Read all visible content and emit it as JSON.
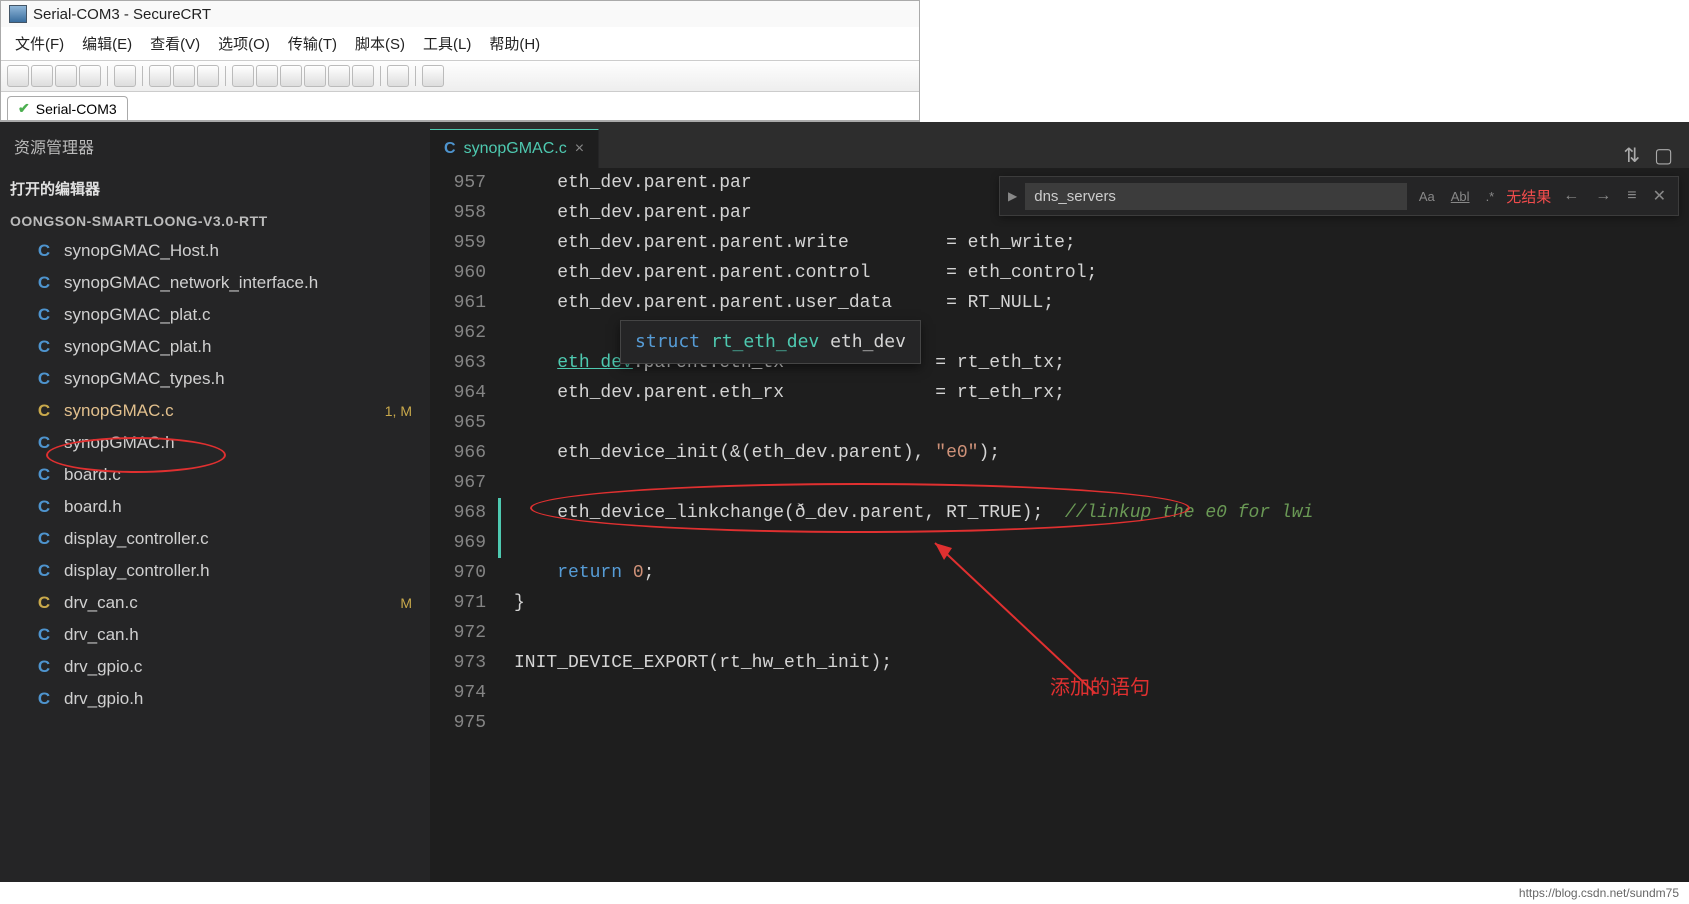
{
  "crt": {
    "title": "Serial-COM3 - SecureCRT",
    "menu": [
      "文件(F)",
      "编辑(E)",
      "查看(V)",
      "选项(O)",
      "传输(T)",
      "脚本(S)",
      "工具(L)",
      "帮助(H)"
    ],
    "tab_label": "Serial-COM3"
  },
  "vscode": {
    "explorer_title": "资源管理器",
    "open_editors_label": "打开的编辑器",
    "project_name": "OONGSON-SMARTLOONG-V3.0-RTT",
    "files": [
      {
        "name": "synopGMAC_Host.h",
        "status": ""
      },
      {
        "name": "synopGMAC_network_interface.h",
        "status": ""
      },
      {
        "name": "synopGMAC_plat.c",
        "status": ""
      },
      {
        "name": "synopGMAC_plat.h",
        "status": ""
      },
      {
        "name": "synopGMAC_types.h",
        "status": ""
      },
      {
        "name": "synopGMAC.c",
        "status": "1, M",
        "active": true,
        "yellow": true
      },
      {
        "name": "synopGMAC.h",
        "status": ""
      },
      {
        "name": "board.c",
        "status": ""
      },
      {
        "name": "board.h",
        "status": ""
      },
      {
        "name": "display_controller.c",
        "status": ""
      },
      {
        "name": "display_controller.h",
        "status": ""
      },
      {
        "name": "drv_can.c",
        "status": "M",
        "yellow": true
      },
      {
        "name": "drv_can.h",
        "status": ""
      },
      {
        "name": "drv_gpio.c",
        "status": ""
      },
      {
        "name": "drv_gpio.h",
        "status": ""
      }
    ],
    "tab_file": "synopGMAC.c",
    "find": {
      "value": "dns_servers",
      "result": "无结果",
      "opts": {
        "case": "Aa",
        "word": "Abl",
        "regex": ".*"
      }
    },
    "hover_tip": {
      "keyword": "struct",
      "type": "rt_eth_dev",
      "var": "eth_dev"
    },
    "line_start": 957,
    "code_lines": [
      {
        "n": 957,
        "html": "    eth_dev.parent.par"
      },
      {
        "n": 958,
        "html": "    eth_dev.parent.par"
      },
      {
        "n": 959,
        "html": "    eth_dev.parent.parent.write         = eth_write;"
      },
      {
        "n": 960,
        "html": "    eth_dev.parent.parent.control       = eth_control;"
      },
      {
        "n": 961,
        "html": "    eth_dev.parent.parent.user_data     = RT_NULL;"
      },
      {
        "n": 962,
        "html": ""
      },
      {
        "n": 963,
        "html": "    <u>eth_dev</u>.parent.eth_tx              = rt_eth_tx;"
      },
      {
        "n": 964,
        "html": "    eth_dev.parent.eth_rx              = rt_eth_rx;"
      },
      {
        "n": 965,
        "html": ""
      },
      {
        "n": 966,
        "html": "    eth_device_init(&(eth_dev.parent), <s>\"e0\"</s>);"
      },
      {
        "n": 967,
        "html": ""
      },
      {
        "n": 968,
        "html": "    eth_device_linkchange(&eth_dev.parent, RT_TRUE);  <c>//linkup the e0 for lwi</c>",
        "mod": true
      },
      {
        "n": 969,
        "html": "",
        "mod": true
      },
      {
        "n": 970,
        "html": "    <k>return</k> <s>0</s>;"
      },
      {
        "n": 971,
        "html": "}"
      },
      {
        "n": 972,
        "html": ""
      },
      {
        "n": 973,
        "html": "INIT_DEVICE_EXPORT(rt_hw_eth_init);"
      },
      {
        "n": 974,
        "html": ""
      },
      {
        "n": 975,
        "html": ""
      }
    ],
    "annotations": {
      "added_text": "添加的语句"
    }
  },
  "watermark": "https://blog.csdn.net/sundm75"
}
